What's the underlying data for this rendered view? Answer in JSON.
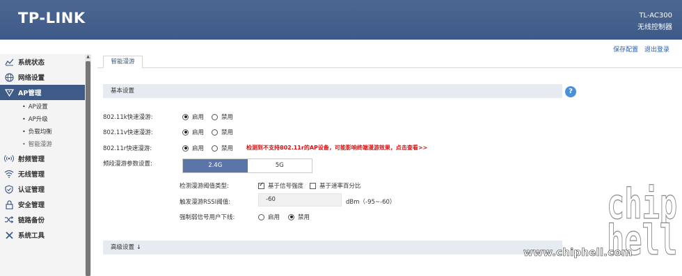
{
  "header": {
    "logo": "TP-LINK",
    "model": "TL-AC300",
    "product": "无线控制器"
  },
  "toplinks": {
    "save": "保存配置",
    "logout": "退出登录"
  },
  "sidebar": {
    "items": [
      {
        "label": "系统状态",
        "icon": "chart-line-icon"
      },
      {
        "label": "网络设置",
        "icon": "globe-icon"
      },
      {
        "label": "AP管理",
        "icon": "ap-icon"
      },
      {
        "label": "射频管理",
        "icon": "radio-wave-icon"
      },
      {
        "label": "无线管理",
        "icon": "wifi-icon"
      },
      {
        "label": "认证管理",
        "icon": "shield-icon"
      },
      {
        "label": "安全管理",
        "icon": "lock-icon"
      },
      {
        "label": "链路备份",
        "icon": "shuffle-icon"
      },
      {
        "label": "系统工具",
        "icon": "tools-icon"
      }
    ],
    "subitems": [
      "AP设置",
      "AP升级",
      "负载均衡",
      "智能漫游"
    ]
  },
  "tab": "智能漫游",
  "basic": {
    "title": "基本设置",
    "row_k": "802.11k快速漫游:",
    "row_v": "802.11v快速漫游:",
    "row_r": "802.11r快速漫游:",
    "enable": "启用",
    "disable": "禁用",
    "warning": "检测到不支持802.11r的AP设备，可能影响终端漫游效果，点击查看>>",
    "band_label": "频段漫游参数设置:",
    "band_24": "2.4G",
    "band_5": "5G",
    "detect_label": "检测漫游阈值类型:",
    "detect_signal": "基于信号强度",
    "detect_rate": "基于速率百分比",
    "rssi_label": "触发漫游RSSI阈值:",
    "rssi_value": "-60",
    "rssi_unit": "dBm（-95~-60）",
    "force_label": "强制弱信号用户下线:"
  },
  "advanced": {
    "title": "高级设置 ↓"
  },
  "watermark": {
    "site": "www.chiphell.com",
    "logo": "chip hell"
  },
  "colors": {
    "header": "#3e5a86",
    "accent": "#5b76a6",
    "warning": "#e01010",
    "section_bg": "#e6ebf2"
  }
}
